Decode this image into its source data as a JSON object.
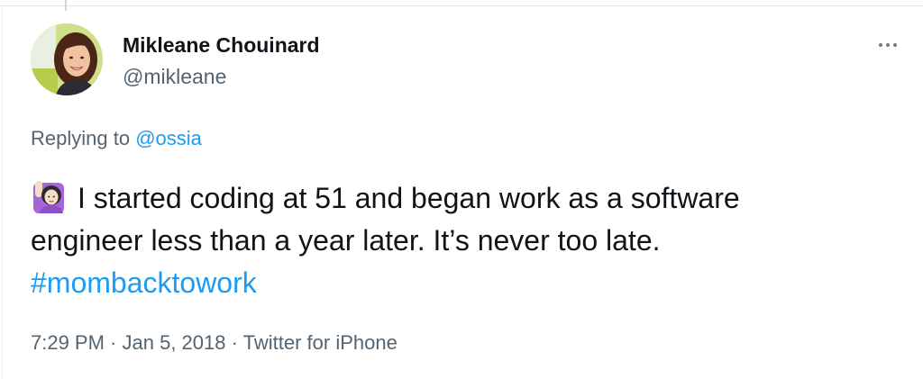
{
  "author": {
    "display_name": "Mikleane Chouinard",
    "handle": "@mikleane",
    "avatar_icon": "profile-photo"
  },
  "more_menu_icon": "ellipsis-icon",
  "reply": {
    "prefix": "Replying to ",
    "mention": "@ossia"
  },
  "tweet": {
    "emoji_icon": "raising-hand-woman-emoji",
    "line1": "I started coding at 51 and began work as a software",
    "line2": "engineer less than a year later. It’s never too late.",
    "hashtag": "#mombacktowork"
  },
  "meta": {
    "time": "7:29 PM",
    "separator1": " · ",
    "date": "Jan 5, 2018",
    "separator2": " · ",
    "source": "Twitter for iPhone"
  },
  "colors": {
    "link": "#1d9bf0",
    "secondary_text": "#536471",
    "primary_text": "#0f1419"
  }
}
